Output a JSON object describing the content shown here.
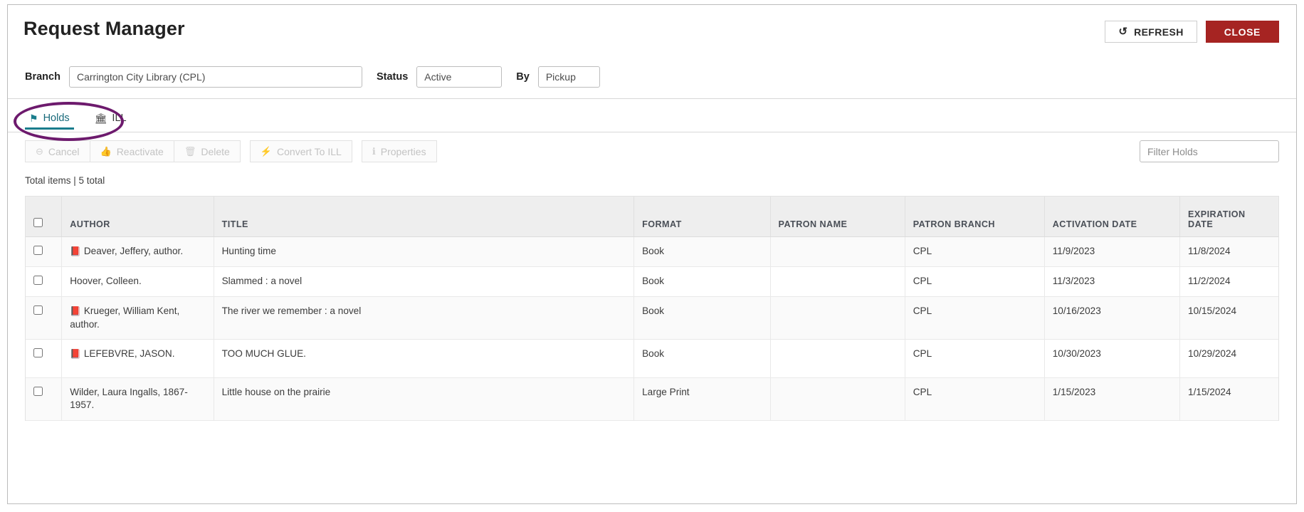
{
  "header": {
    "title": "Request Manager",
    "refresh_label": "REFRESH",
    "refresh_icon": "refresh-icon",
    "close_label": "CLOSE"
  },
  "filters": {
    "branch_label": "Branch",
    "branch_value": "Carrington City Library (CPL)",
    "status_label": "Status",
    "status_value": "Active",
    "by_label": "By",
    "by_value": "Pickup"
  },
  "tabs": [
    {
      "label": "Holds",
      "icon": "flag-icon",
      "glyph": "⚑",
      "active": true
    },
    {
      "label": "ILL",
      "icon": "library-building-icon",
      "glyph": "🏛",
      "active": false
    }
  ],
  "toolbar": {
    "buttons": [
      {
        "label": "Cancel",
        "icon": "minus-circle-icon",
        "glyph": "⊖",
        "disabled": true
      },
      {
        "label": "Reactivate",
        "icon": "thumbs-up-icon",
        "glyph": "👍",
        "disabled": true
      },
      {
        "label": "Delete",
        "icon": "trash-icon",
        "glyph": "🗑",
        "disabled": true
      },
      {
        "label": "Convert To ILL",
        "icon": "lightning-bolt-icon",
        "glyph": "⚡",
        "disabled": true
      },
      {
        "label": "Properties",
        "icon": "info-circle-icon",
        "glyph": "ℹ",
        "disabled": true
      }
    ],
    "filter_placeholder": "Filter Holds",
    "filter_value": ""
  },
  "total_line": "Total items | 5 total",
  "table": {
    "columns": [
      "AUTHOR",
      "TITLE",
      "FORMAT",
      "PATRON NAME",
      "PATRON BRANCH",
      "ACTIVATION DATE",
      "EXPIRATION DATE"
    ],
    "rows": [
      {
        "has_book_icon": true,
        "author": "Deaver, Jeffery, author.",
        "title": "Hunting time",
        "format": "Book",
        "patron_name": "",
        "patron_branch": "CPL",
        "activation_date": "11/9/2023",
        "expiration_date": "11/8/2024"
      },
      {
        "has_book_icon": false,
        "author": "Hoover, Colleen.",
        "title": "Slammed : a novel",
        "format": "Book",
        "patron_name": "",
        "patron_branch": "CPL",
        "activation_date": "11/3/2023",
        "expiration_date": "11/2/2024"
      },
      {
        "has_book_icon": true,
        "author": "Krueger, William Kent, author.",
        "title": "The river we remember : a novel",
        "format": "Book",
        "patron_name": "",
        "patron_branch": "CPL",
        "activation_date": "10/16/2023",
        "expiration_date": "10/15/2024"
      },
      {
        "has_book_icon": true,
        "author": "LEFEBVRE, JASON.",
        "title": "TOO MUCH GLUE.",
        "format": "Book",
        "patron_name": "",
        "patron_branch": "CPL",
        "activation_date": "10/30/2023",
        "expiration_date": "10/29/2024"
      },
      {
        "has_book_icon": false,
        "author": "Wilder, Laura Ingalls, 1867-1957.",
        "title": "Little house on the prairie",
        "format": "Large Print",
        "patron_name": "",
        "patron_branch": "CPL",
        "activation_date": "1/15/2023",
        "expiration_date": "1/15/2024"
      }
    ]
  },
  "annotation": {
    "shape": "oval",
    "color": "#6d1a6d",
    "target": "tab-strip"
  },
  "colors": {
    "close_button": "#a62422",
    "active_tab": "#1a7d8c",
    "annotation": "#6d1a6d",
    "header_background": "#eeeeee"
  }
}
